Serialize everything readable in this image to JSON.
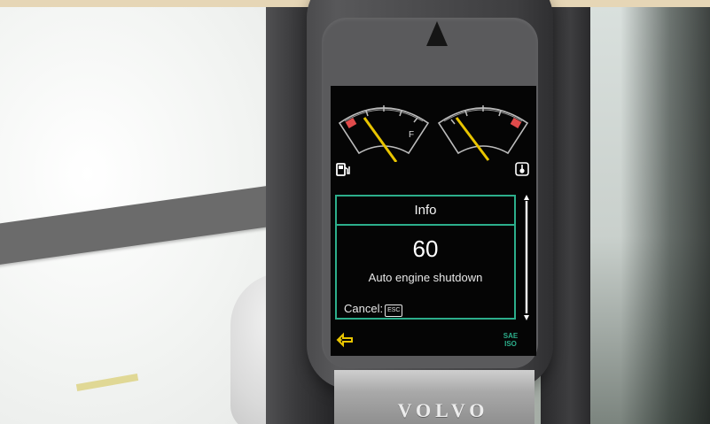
{
  "info_panel": {
    "title": "Info",
    "value": "60",
    "message": "Auto engine shutdown",
    "cancel_label": "Cancel:",
    "cancel_key": "ESC"
  },
  "gauges": {
    "fuel": {
      "full_mark": "F"
    },
    "coolant": {}
  },
  "status": {
    "standard_top": "SAE",
    "standard_bottom": "ISO"
  },
  "brand": "VOLVO",
  "colors": {
    "accent": "#2cae8b",
    "needle": "#e9c500",
    "warning": "#e04b4b",
    "screen_bg": "#050505"
  },
  "icons": [
    "fuel-pump-icon",
    "coolant-temperature-icon",
    "hydraulic-icon",
    "scroll-up-icon",
    "scroll-down-icon"
  ]
}
